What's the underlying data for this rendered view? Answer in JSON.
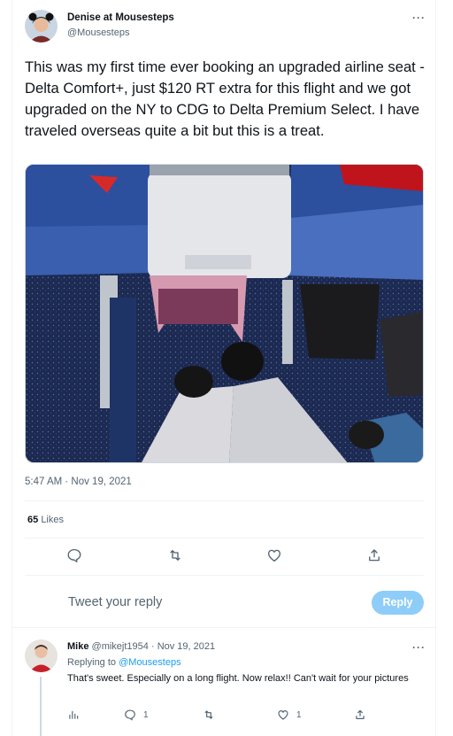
{
  "tweet": {
    "author_name": "Denise at Mousesteps",
    "author_handle": "@Mousesteps",
    "more_label": "···",
    "text": "This was my first time ever booking an upgraded airline seat - Delta Comfort+, just $120 RT extra for this flight and we got upgraded on the NY to CDG to Delta Premium Select. I have traveled overseas quite a bit but this is a treat.",
    "timestamp": "5:47 AM · Nov 19, 2021",
    "likes_count": "65",
    "likes_label": "Likes",
    "photo_icon": "airplane-legroom-photo"
  },
  "actions": {
    "reply_icon": "reply-icon",
    "retweet_icon": "retweet-icon",
    "like_icon": "heart-icon",
    "share_icon": "share-icon"
  },
  "composer": {
    "placeholder": "Tweet your reply",
    "reply_button_label": "Reply"
  },
  "reply": {
    "author_name": "Mike",
    "author_handle": "@mikejt1954",
    "date": "· Nov 19, 2021",
    "more_label": "···",
    "replying_to_label": "Replying to",
    "replying_to_handle": "@Mousesteps",
    "text": "That's sweet. Especially on a long flight. Now relax!!  Can't wait for your pictures",
    "reply_count": "1",
    "like_count": "1"
  },
  "colors": {
    "accent": "#1d9bf0",
    "reply_button_disabled": "#8ecdf8",
    "secondary_text": "#536471"
  }
}
